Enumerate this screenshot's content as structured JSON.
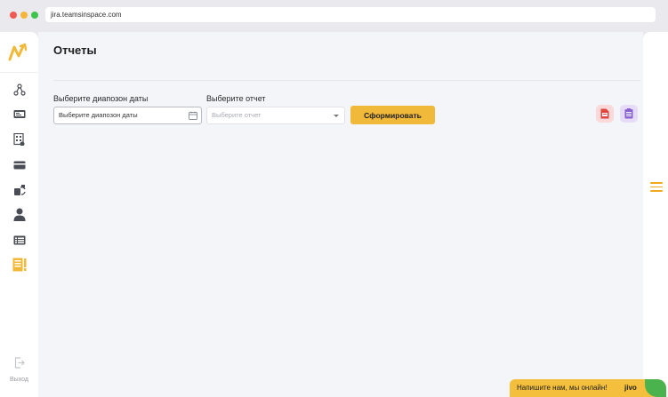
{
  "browser": {
    "url": "jira.teamsinspace.com"
  },
  "sidebar": {
    "items": [
      {
        "name": "structure-icon"
      },
      {
        "name": "monitor-icon"
      },
      {
        "name": "document-grid-icon"
      },
      {
        "name": "card-icon"
      },
      {
        "name": "refresh-cup-icon"
      },
      {
        "name": "user-icon"
      },
      {
        "name": "list-icon"
      },
      {
        "name": "report-icon",
        "active": true
      }
    ],
    "exit_label": "Выход",
    "accent": "#f0b93a"
  },
  "page": {
    "title": "Отчеты",
    "date_range": {
      "label": "Выберите диапозон даты",
      "placeholder": "Выберите диапозон даты"
    },
    "report": {
      "label": "Выберите отчет",
      "placeholder": "Выберите отчет"
    },
    "generate_label": "Сформировать"
  },
  "chat": {
    "text": "Напишите нам, мы онлайн!",
    "brand": "jivo"
  }
}
